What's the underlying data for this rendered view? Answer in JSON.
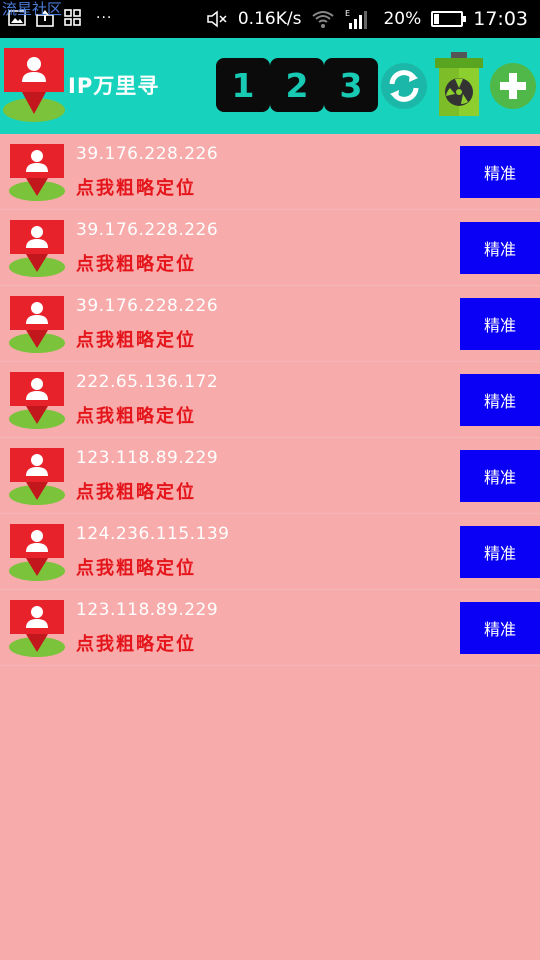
{
  "status_bar": {
    "watermark": "流星社区",
    "more": "···",
    "speed": "0.16K/s",
    "signal_label": "E",
    "battery_percent": "20%",
    "battery_level": 0.2,
    "time": "17:03"
  },
  "toolbar": {
    "title": "IP万里寻",
    "tab_1": "1",
    "tab_2": "2",
    "tab_3": "3",
    "refresh_icon": "refresh-icon",
    "trash_icon": "trash-icon",
    "add_icon": "add-icon"
  },
  "colors": {
    "toolbar_bg": "#17d3bd",
    "list_bg": "#f8abab",
    "accent_button": "#0a00f5",
    "link_red": "#e4151b"
  },
  "list": {
    "items": [
      {
        "ip": "39.176.228.226",
        "action": "点我粗略定位",
        "button": "精准"
      },
      {
        "ip": "39.176.228.226",
        "action": "点我粗略定位",
        "button": "精准"
      },
      {
        "ip": "39.176.228.226",
        "action": "点我粗略定位",
        "button": "精准"
      },
      {
        "ip": "222.65.136.172",
        "action": "点我粗略定位",
        "button": "精准"
      },
      {
        "ip": "123.118.89.229",
        "action": "点我粗略定位",
        "button": "精准"
      },
      {
        "ip": "124.236.115.139",
        "action": "点我粗略定位",
        "button": "精准"
      },
      {
        "ip": "123.118.89.229",
        "action": "点我粗略定位",
        "button": "精准"
      }
    ]
  }
}
